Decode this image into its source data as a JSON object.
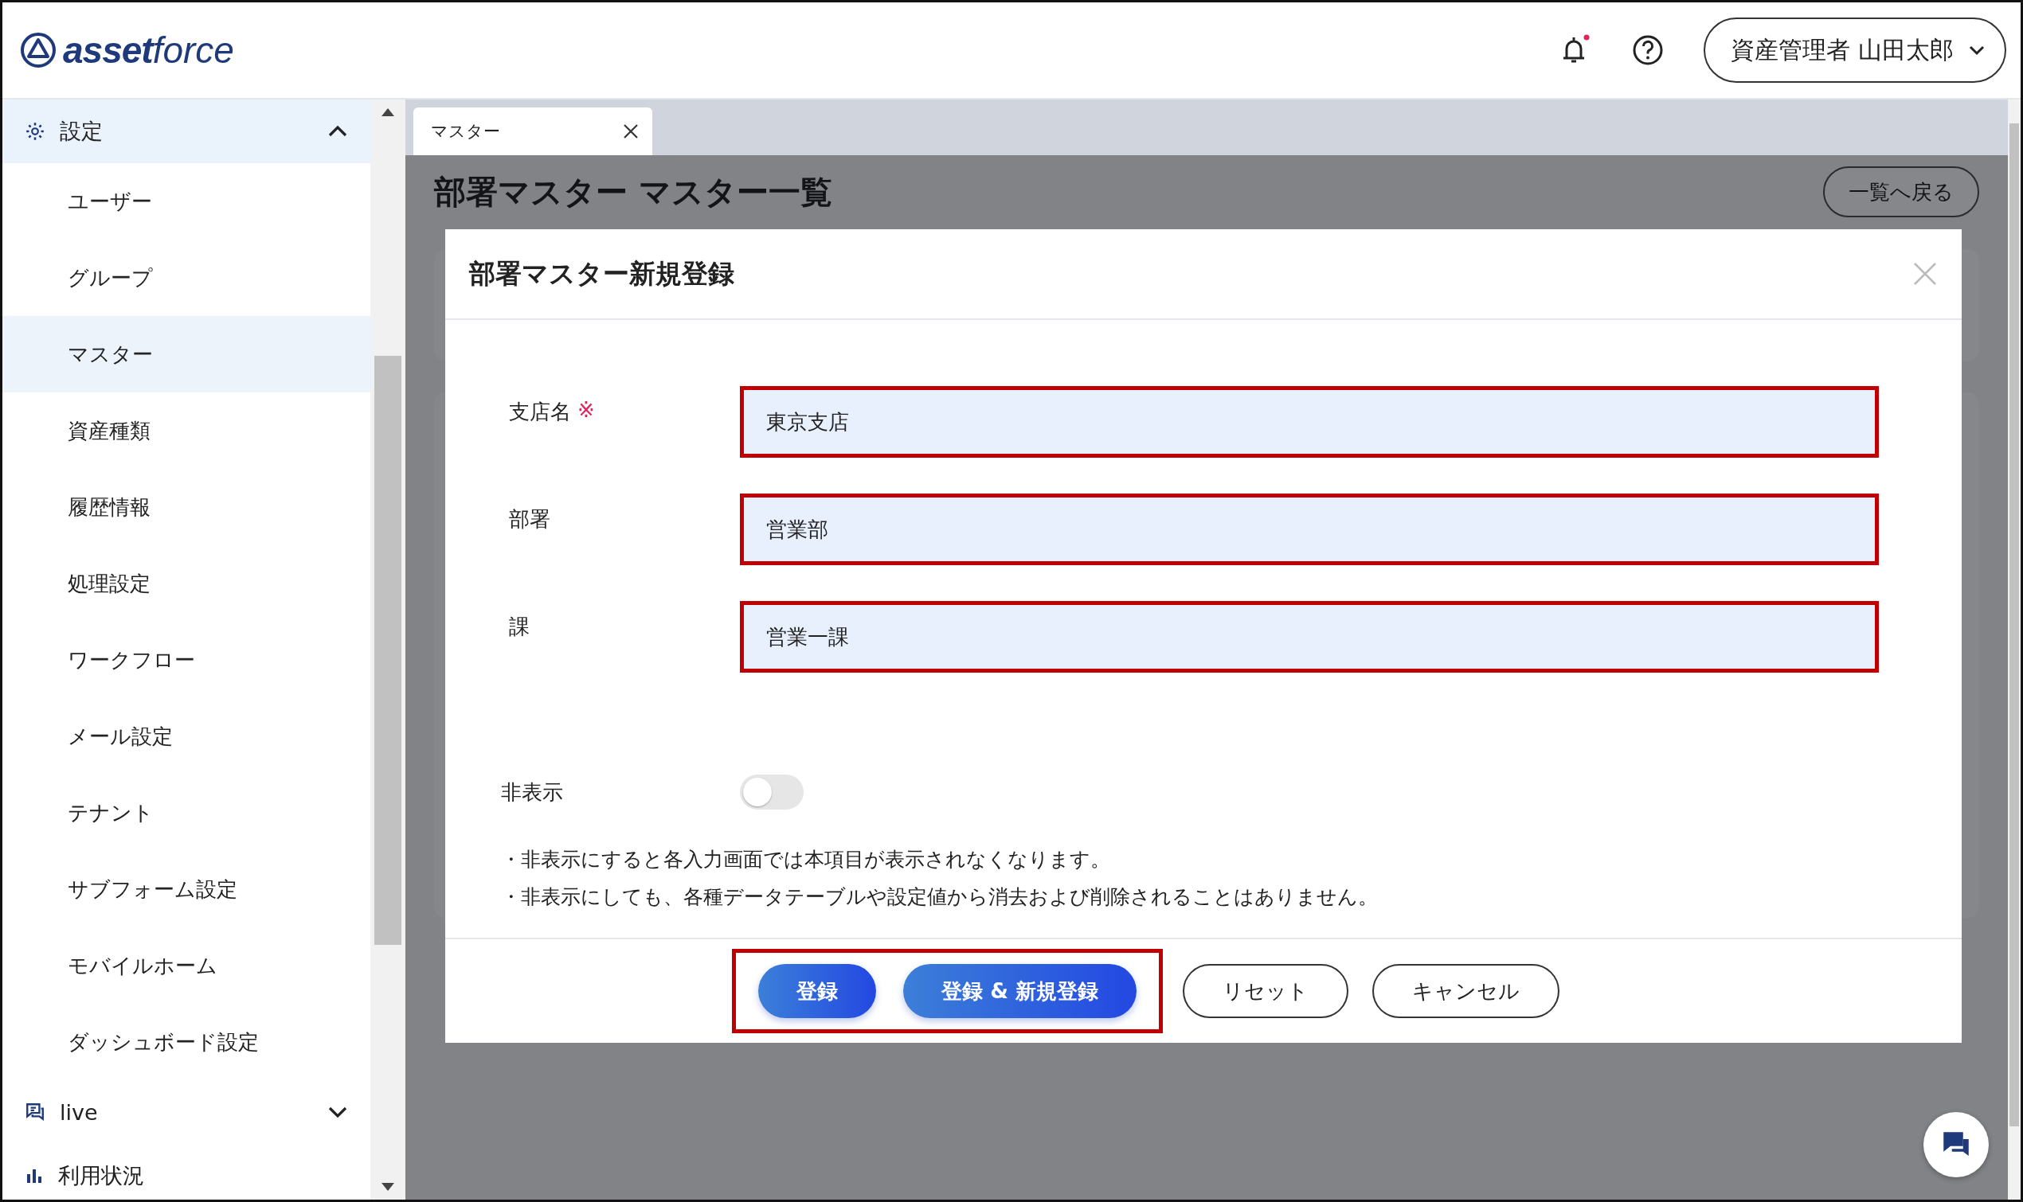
{
  "header": {
    "logo_bold": "asset",
    "logo_light": "force",
    "notification_unread": true,
    "user_menu": "資産管理者 山田太郎"
  },
  "sidebar": {
    "sections": [
      {
        "kind": "gear",
        "label": "設定",
        "expanded": true,
        "items": [
          {
            "label": "ユーザー",
            "selected": false
          },
          {
            "label": "グループ",
            "selected": false
          },
          {
            "label": "マスター",
            "selected": true
          },
          {
            "label": "資産種類",
            "selected": false
          },
          {
            "label": "履歴情報",
            "selected": false
          },
          {
            "label": "処理設定",
            "selected": false
          },
          {
            "label": "ワークフロー",
            "selected": false
          },
          {
            "label": "メール設定",
            "selected": false
          },
          {
            "label": "テナント",
            "selected": false
          },
          {
            "label": "サブフォーム設定",
            "selected": false
          },
          {
            "label": "モバイルホーム",
            "selected": false
          },
          {
            "label": "ダッシュボード設定",
            "selected": false
          }
        ]
      },
      {
        "kind": "chat",
        "label": "live",
        "expanded": false
      },
      {
        "kind": "chart",
        "label": "利用状況"
      }
    ]
  },
  "tabs": [
    {
      "label": "マスター",
      "selected": true
    }
  ],
  "page": {
    "title": "部署マスター マスター一覧",
    "back_button": "一覧へ戻る"
  },
  "dialog": {
    "title": "部署マスター新規登録",
    "fields": [
      {
        "label": "支店名",
        "required_mark": "※",
        "value": "東京支店",
        "highlighted": true
      },
      {
        "label": "部署",
        "value": "営業部",
        "highlighted": true
      },
      {
        "label": "課",
        "value": "営業一課",
        "highlighted": true
      }
    ],
    "toggle": {
      "label": "非表示",
      "on": false
    },
    "notes": [
      "・非表示にすると各入力画面では本項目が表示されなくなります。",
      "・非表示にしても、各種データテーブルや設定値から消去および削除されることはありません。"
    ],
    "buttons": [
      {
        "label": "登録",
        "kind": "primary",
        "highlighted": true
      },
      {
        "label": "登録 & 新規登録",
        "kind": "primary",
        "highlighted": true
      },
      {
        "label": "リセット",
        "kind": "outline",
        "highlighted": false
      },
      {
        "label": "キャンセル",
        "kind": "outline",
        "highlighted": false
      }
    ]
  }
}
